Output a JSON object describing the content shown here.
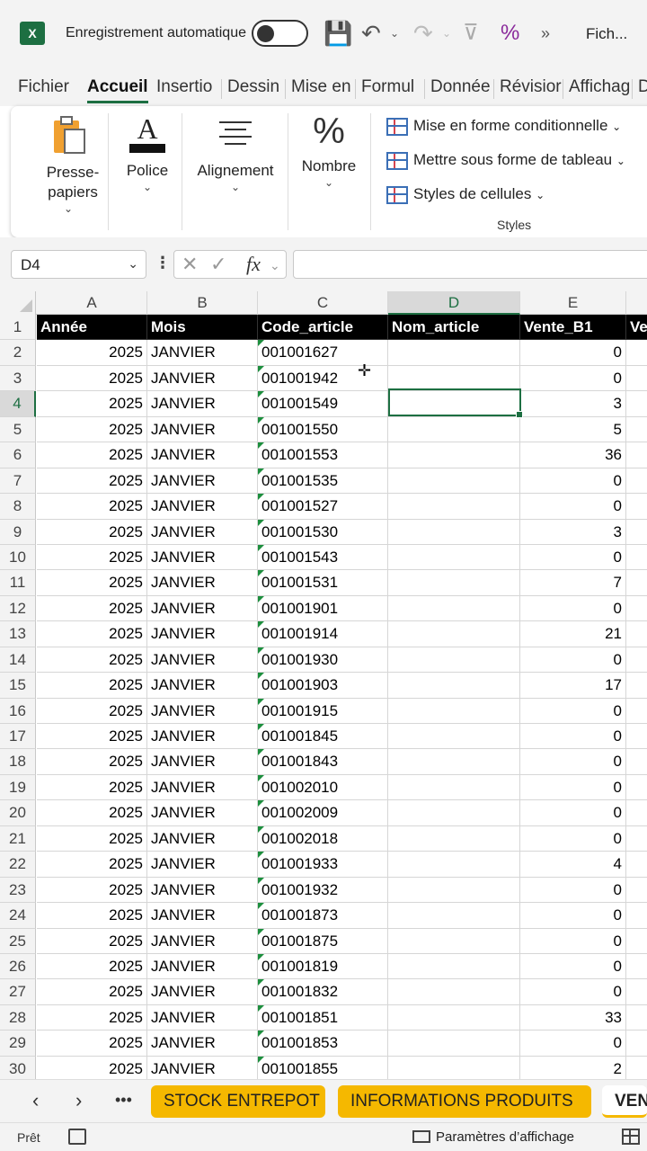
{
  "titlebar": {
    "app_logo": "X",
    "autosave_label": "Enregistrement automatique",
    "autosave_on": false,
    "file_name": "Fich..."
  },
  "ribbon": {
    "tabs": [
      "Fichier",
      "Accueil",
      "Insertio",
      "Dessin",
      "Mise en",
      "Formul",
      "Donnée",
      "Révisior",
      "Affichag",
      "D"
    ],
    "active_tab": "Accueil",
    "groups": {
      "clipboard": "Presse-papiers",
      "font": "Police",
      "alignment": "Alignement",
      "number": "Nombre"
    },
    "styles": {
      "conditional": "Mise en forme conditionnelle",
      "table": "Mettre sous forme de tableau",
      "cell_styles": "Styles de cellules",
      "group_label": "Styles"
    }
  },
  "formula_bar": {
    "name_box": "D4",
    "formula": ""
  },
  "grid": {
    "columns": [
      "A",
      "B",
      "C",
      "D",
      "E"
    ],
    "selected_column": "D",
    "selected_row": 4,
    "header_row": [
      "Année",
      "Mois",
      "Code_article",
      "Nom_article",
      "Vente_B1",
      "Ve"
    ],
    "rows": [
      [
        "2025",
        "JANVIER",
        "001001627",
        "",
        "0"
      ],
      [
        "2025",
        "JANVIER",
        "001001942",
        "",
        "0"
      ],
      [
        "2025",
        "JANVIER",
        "001001549",
        "",
        "3"
      ],
      [
        "2025",
        "JANVIER",
        "001001550",
        "",
        "5"
      ],
      [
        "2025",
        "JANVIER",
        "001001553",
        "",
        "36"
      ],
      [
        "2025",
        "JANVIER",
        "001001535",
        "",
        "0"
      ],
      [
        "2025",
        "JANVIER",
        "001001527",
        "",
        "0"
      ],
      [
        "2025",
        "JANVIER",
        "001001530",
        "",
        "3"
      ],
      [
        "2025",
        "JANVIER",
        "001001543",
        "",
        "0"
      ],
      [
        "2025",
        "JANVIER",
        "001001531",
        "",
        "7"
      ],
      [
        "2025",
        "JANVIER",
        "001001901",
        "",
        "0"
      ],
      [
        "2025",
        "JANVIER",
        "001001914",
        "",
        "21"
      ],
      [
        "2025",
        "JANVIER",
        "001001930",
        "",
        "0"
      ],
      [
        "2025",
        "JANVIER",
        "001001903",
        "",
        "17"
      ],
      [
        "2025",
        "JANVIER",
        "001001915",
        "",
        "0"
      ],
      [
        "2025",
        "JANVIER",
        "001001845",
        "",
        "0"
      ],
      [
        "2025",
        "JANVIER",
        "001001843",
        "",
        "0"
      ],
      [
        "2025",
        "JANVIER",
        "001002010",
        "",
        "0"
      ],
      [
        "2025",
        "JANVIER",
        "001002009",
        "",
        "0"
      ],
      [
        "2025",
        "JANVIER",
        "001002018",
        "",
        "0"
      ],
      [
        "2025",
        "JANVIER",
        "001001933",
        "",
        "4"
      ],
      [
        "2025",
        "JANVIER",
        "001001932",
        "",
        "0"
      ],
      [
        "2025",
        "JANVIER",
        "001001873",
        "",
        "0"
      ],
      [
        "2025",
        "JANVIER",
        "001001875",
        "",
        "0"
      ],
      [
        "2025",
        "JANVIER",
        "001001819",
        "",
        "0"
      ],
      [
        "2025",
        "JANVIER",
        "001001832",
        "",
        "0"
      ],
      [
        "2025",
        "JANVIER",
        "001001851",
        "",
        "33"
      ],
      [
        "2025",
        "JANVIER",
        "001001853",
        "",
        "0"
      ],
      [
        "2025",
        "JANVIER",
        "001001855",
        "",
        "2"
      ]
    ]
  },
  "sheets": {
    "tabs": [
      "STOCK ENTREPOT",
      "INFORMATIONS PRODUITS",
      "VEN"
    ],
    "active": "VEN",
    "tab_color": "#f5b800"
  },
  "status": {
    "ready": "Prêt",
    "display_settings": "Paramètres d’affichage"
  },
  "colors": {
    "accent": "#1d6f42",
    "header_bg": "#000000",
    "header_text": "#ffffff"
  }
}
